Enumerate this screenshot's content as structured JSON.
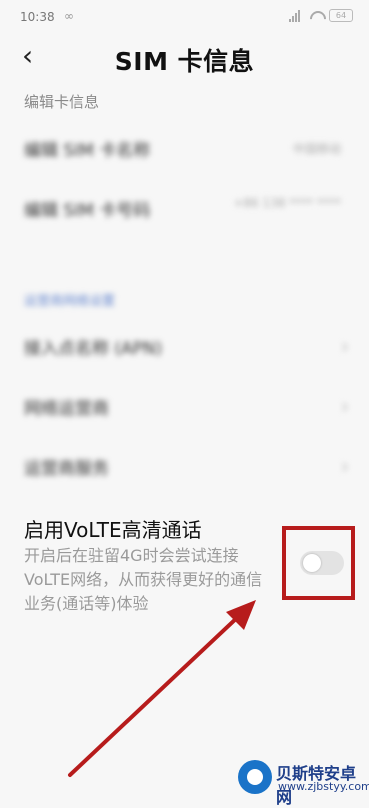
{
  "status": {
    "time": "10:38",
    "extra": "∞",
    "battery": "64"
  },
  "header": {
    "back": "‹",
    "title": "SIM 卡信息"
  },
  "section_label": "编辑卡信息",
  "blurred": {
    "rows": [
      {
        "label": "编辑 SIM 卡名称",
        "value": "中国移动"
      },
      {
        "label": "编辑 SIM 卡号码",
        "value": "+86 138 **** ****"
      }
    ],
    "group_header": "运营商网络设置",
    "settings": [
      {
        "label": "接入点名称 (APN)",
        "chevron": "›"
      },
      {
        "label": "网络运营商",
        "chevron": "›"
      },
      {
        "label": "运营商服务",
        "chevron": "›"
      }
    ]
  },
  "volte": {
    "title": "启用VoLTE高清通话",
    "desc": "开启后在驻留4G时会尝试连接VoLTE网络，从而获得更好的通信业务(通话等)体验",
    "toggle_on": false
  },
  "annotation_color": "#b71c1c",
  "watermark": {
    "name": "贝斯特安卓网",
    "url": "www.zjbstyy.com"
  }
}
